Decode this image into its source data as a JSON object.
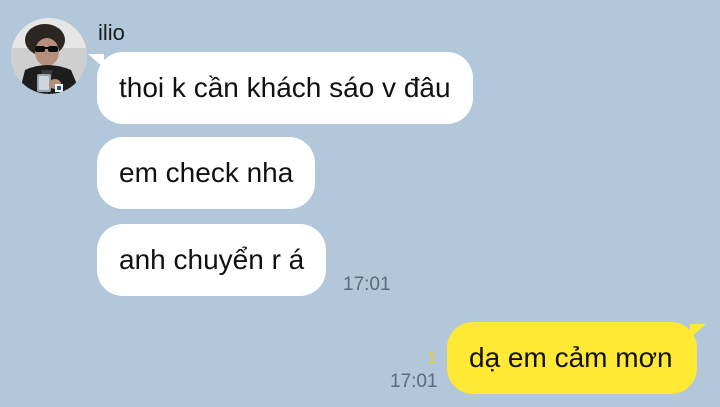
{
  "conversation": {
    "sender": {
      "name": "ilio",
      "avatar_icon": "profile-photo"
    },
    "incoming": [
      {
        "text": "thoi k cần khách sáo v đâu"
      },
      {
        "text": "em check nha"
      },
      {
        "text": "anh chuyển r á"
      }
    ],
    "incoming_time": "17:01",
    "outgoing": {
      "text": "dạ em cảm mơn",
      "time": "17:01",
      "unread_count": "1"
    }
  },
  "colors": {
    "background": "#b2c7d9",
    "incoming_bubble": "#ffffff",
    "outgoing_bubble": "#ffe934",
    "unread_count": "#e8d21d",
    "timestamp": "#5a6b7b"
  }
}
